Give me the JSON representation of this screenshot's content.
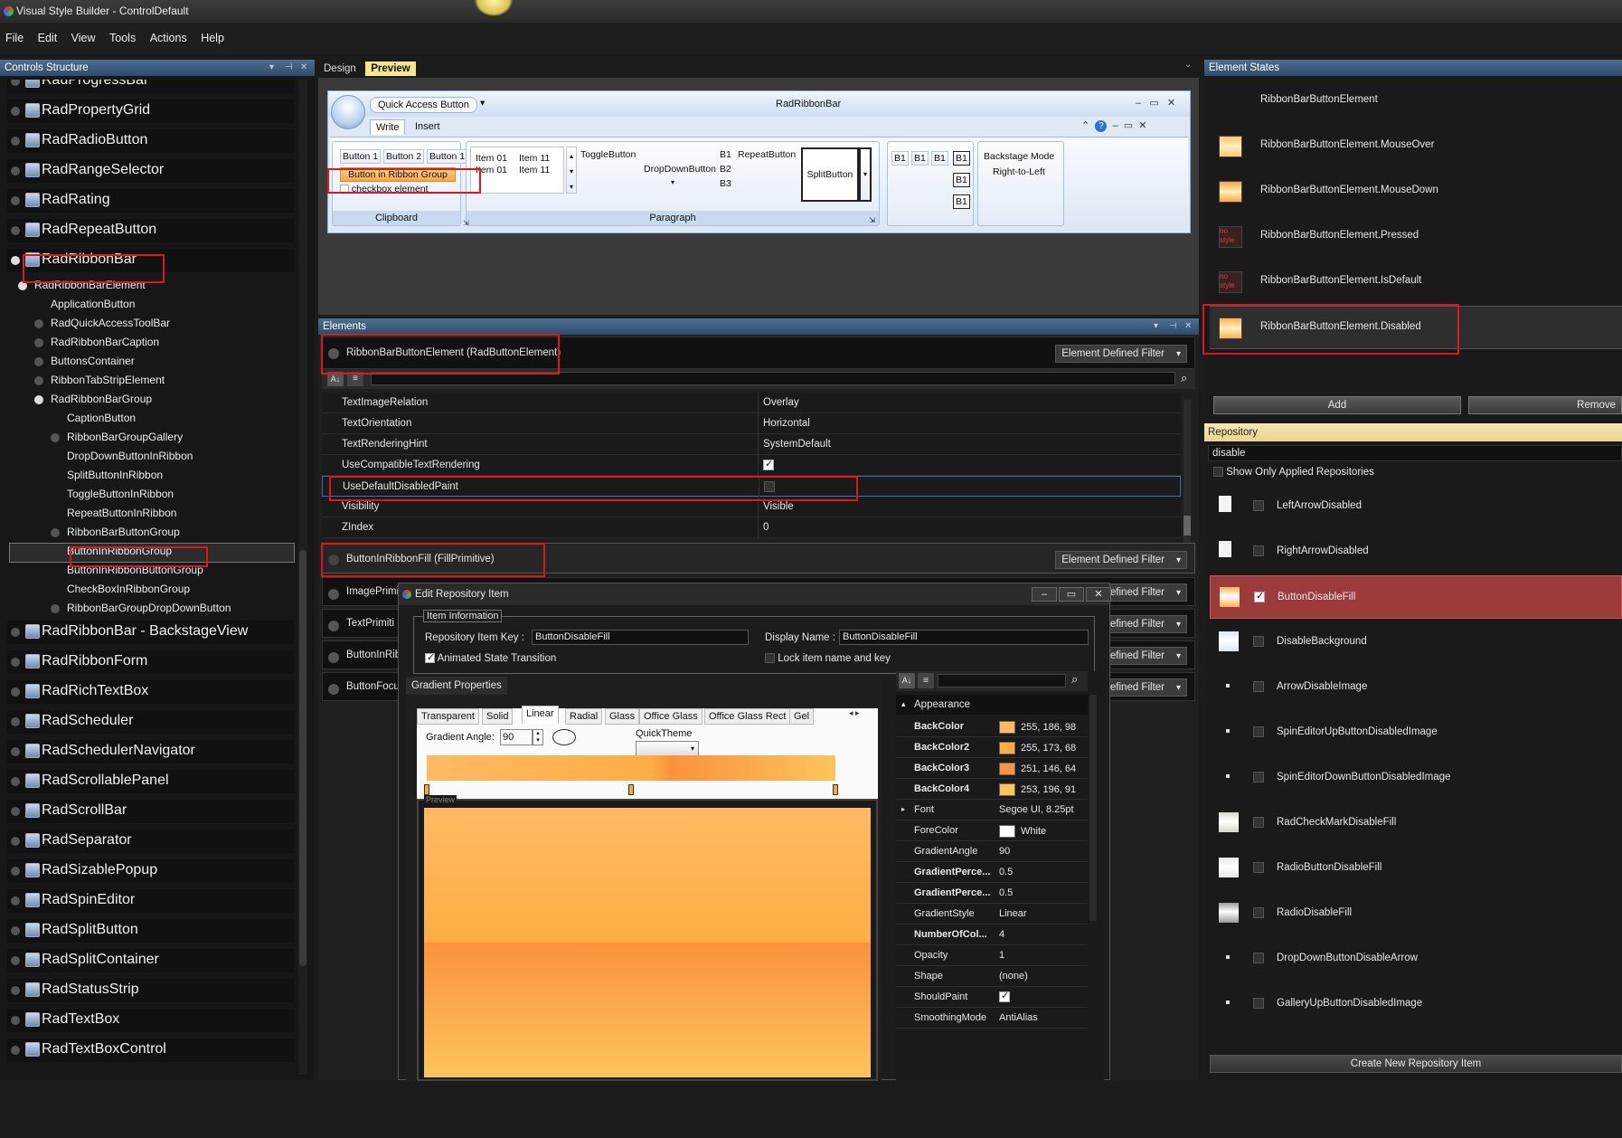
{
  "window": {
    "title": "Visual Style Builder - ControlDefault"
  },
  "menu": [
    "File",
    "Edit",
    "View",
    "Tools",
    "Actions",
    "Help"
  ],
  "left_panel": {
    "title": "Controls Structure",
    "items": [
      {
        "label": "RadProgressBar",
        "level": 0
      },
      {
        "label": "RadPropertyGrid",
        "level": 0
      },
      {
        "label": "RadRadioButton",
        "level": 0
      },
      {
        "label": "RadRangeSelector",
        "level": 0
      },
      {
        "label": "RadRating",
        "level": 0
      },
      {
        "label": "RadRepeatButton",
        "level": 0
      },
      {
        "label": "RadRibbonBar",
        "level": 0,
        "open": true
      },
      {
        "label": "RadRibbonBarElement",
        "level": 1,
        "open": true
      },
      {
        "label": "ApplicationButton",
        "level": 2
      },
      {
        "label": "RadQuickAccessToolBar",
        "level": 2,
        "expandable": true
      },
      {
        "label": "RadRibbonBarCaption",
        "level": 2,
        "expandable": true
      },
      {
        "label": "ButtonsContainer",
        "level": 2,
        "expandable": true
      },
      {
        "label": "RibbonTabStripElement",
        "level": 2,
        "expandable": true
      },
      {
        "label": "RadRibbonBarGroup",
        "level": 2,
        "open": true
      },
      {
        "label": "CaptionButton",
        "level": 3
      },
      {
        "label": "RibbonBarGroupGallery",
        "level": 3,
        "expandable": true
      },
      {
        "label": "DropDownButtonInRibbon",
        "level": 3
      },
      {
        "label": "SplitButtonInRibbon",
        "level": 3
      },
      {
        "label": "ToggleButtonInRibbon",
        "level": 3
      },
      {
        "label": "RepeatButtonInRibbon",
        "level": 3
      },
      {
        "label": "RibbonBarButtonGroup",
        "level": 3,
        "expandable": true
      },
      {
        "label": "ButtonInRibbonGroup",
        "level": 3,
        "selected": true
      },
      {
        "label": "ButtonInRibbonButtonGroup",
        "level": 3
      },
      {
        "label": "CheckBoxInRibbonGroup",
        "level": 3
      },
      {
        "label": "RibbonBarGroupDropDownButton",
        "level": 3,
        "expandable": true
      },
      {
        "label": "RadRibbonBar - BackstageView",
        "level": 0
      },
      {
        "label": "RadRibbonForm",
        "level": 0
      },
      {
        "label": "RadRichTextBox",
        "level": 0
      },
      {
        "label": "RadScheduler",
        "level": 0
      },
      {
        "label": "RadSchedulerNavigator",
        "level": 0
      },
      {
        "label": "RadScrollablePanel",
        "level": 0
      },
      {
        "label": "RadScrollBar",
        "level": 0
      },
      {
        "label": "RadSeparator",
        "level": 0
      },
      {
        "label": "RadSizablePopup",
        "level": 0
      },
      {
        "label": "RadSpinEditor",
        "level": 0
      },
      {
        "label": "RadSplitButton",
        "level": 0
      },
      {
        "label": "RadSplitContainer",
        "level": 0
      },
      {
        "label": "RadStatusStrip",
        "level": 0
      },
      {
        "label": "RadTextBox",
        "level": 0
      },
      {
        "label": "RadTextBoxControl",
        "level": 0
      }
    ]
  },
  "center_tabs": {
    "design": "Design",
    "preview": "Preview"
  },
  "ribbon": {
    "quick_access": "Quick Access Button",
    "title": "RadRibbonBar",
    "tabs": [
      "Write",
      "Insert"
    ],
    "clipboard": {
      "buttons": [
        "Button 1",
        "Button 2",
        "Button 1"
      ],
      "highlight": "Button in Ribbon Group",
      "checkbox": "checkbox element",
      "caption": "Clipboard"
    },
    "paragraph": {
      "items": [
        "Item 01",
        "Item 11",
        "Item 01",
        "Item 11"
      ],
      "toggle": "ToggleButton",
      "dropdown": "DropDownButton",
      "b_labels": [
        "B1",
        "B2",
        "B3"
      ],
      "repeat": "RepeatButton",
      "split": "SplitButton",
      "caption": "Paragraph"
    },
    "group3": {
      "b": [
        "B1",
        "B1",
        "B1",
        "B1",
        "B1",
        "B1"
      ]
    },
    "backstage": {
      "line1": "Backstage Mode",
      "line2": "Right-to-Left"
    }
  },
  "elements_panel": {
    "title": "Elements",
    "header1": "RibbonBarButtonElement (RadButtonElement)",
    "filter": "Element Defined Filter",
    "properties": [
      {
        "name": "TextImageRelation",
        "value": "Overlay"
      },
      {
        "name": "TextOrientation",
        "value": "Horizontal"
      },
      {
        "name": "TextRenderingHint",
        "value": "SystemDefault"
      },
      {
        "name": "UseCompatibleTextRendering",
        "value": "",
        "check": "on"
      },
      {
        "name": "UseDefaultDisabledPaint",
        "value": "",
        "check": "off"
      },
      {
        "name": "Visibility",
        "value": "Visible"
      },
      {
        "name": "ZIndex",
        "value": "0"
      }
    ],
    "header2": "ButtonInRibbonFill (FillPrimitive)",
    "collapsed": [
      "ImagePrimi",
      "TextPrimiti",
      "ButtonInRib",
      "ButtonFocu"
    ],
    "filter_partial": "efined Filter"
  },
  "dialog": {
    "title": "Edit Repository Item",
    "info_legend": "Item Information",
    "key_label": "Repository Item Key :",
    "key_value": "ButtonDisableFill",
    "display_label": "Display Name :",
    "display_value": "ButtonDisableFill",
    "animated": "Animated State Transition",
    "lock": "Lock item name and key",
    "gradient_tab": "Gradient Properties",
    "gradient_tabs": [
      "Transparent",
      "Solid",
      "Linear",
      "Radial",
      "Glass",
      "Office Glass",
      "Office Glass Rect",
      "Gel"
    ],
    "angle_label": "Gradient Angle:",
    "angle_value": "90",
    "quicktheme": "QuickTheme",
    "preview": "Preview",
    "props_category": "Appearance",
    "props": [
      {
        "name": "BackColor",
        "value": "255, 186, 98",
        "color": "#ffba62",
        "bold": true
      },
      {
        "name": "BackColor2",
        "value": "255, 173, 68",
        "color": "#ffad44",
        "bold": true
      },
      {
        "name": "BackColor3",
        "value": "251, 146, 64",
        "color": "#fb9240",
        "bold": true
      },
      {
        "name": "BackColor4",
        "value": "253, 196, 91",
        "color": "#fdc45b",
        "bold": true
      },
      {
        "name": "Font",
        "value": "Segoe UI, 8.25pt",
        "bold": false
      },
      {
        "name": "ForeColor",
        "value": "White",
        "color": "#ffffff",
        "bold": false
      },
      {
        "name": "GradientAngle",
        "value": "90",
        "bold": false
      },
      {
        "name": "GradientPerce...",
        "value": "0.5",
        "bold": true
      },
      {
        "name": "GradientPerce...",
        "value": "0.5",
        "bold": true
      },
      {
        "name": "GradientStyle",
        "value": "Linear",
        "bold": false
      },
      {
        "name": "NumberOfCol...",
        "value": "4",
        "bold": true
      },
      {
        "name": "Opacity",
        "value": "1",
        "bold": false
      },
      {
        "name": "Shape",
        "value": "(none)",
        "bold": false
      },
      {
        "name": "ShouldPaint",
        "value": "",
        "check": true,
        "bold": false
      },
      {
        "name": "SmoothingMode",
        "value": "AntiAlias",
        "bold": false
      }
    ]
  },
  "states_panel": {
    "title": "Element States",
    "states": [
      {
        "label": "RibbonBarButtonElement",
        "icon": "none"
      },
      {
        "label": "RibbonBarButtonElement.MouseOver",
        "icon": "#ffc66e"
      },
      {
        "label": "RibbonBarButtonElement.MouseDown",
        "icon": "#ffa33c"
      },
      {
        "label": "RibbonBarButtonElement.Pressed",
        "icon": "nostyle"
      },
      {
        "label": "RibbonBarButtonElement.IsDefault",
        "icon": "nostyle"
      },
      {
        "label": "RibbonBarButtonElement.Disabled",
        "icon": "#ffb04c",
        "selected": true
      }
    ],
    "nostyle_text": "no style",
    "add": "Add",
    "remove": "Remove"
  },
  "repository": {
    "title": "Repository",
    "search": "disable",
    "show_only": "Show Only Applied Repositories",
    "items": [
      {
        "label": "LeftArrowDisabled",
        "icon": "#f4f4f4"
      },
      {
        "label": "RightArrowDisabled",
        "icon": "#f4f4f4"
      },
      {
        "label": "ButtonDisableFill",
        "icon": "#ffb04c",
        "checked": true,
        "selected": true
      },
      {
        "label": "DisableBackground",
        "icon": "#dde6f0"
      },
      {
        "label": "ArrowDisableImage",
        "icon": "dot"
      },
      {
        "label": "SpinEditorUpButtonDisabledImage",
        "icon": "dot"
      },
      {
        "label": "SpinEditorDownButtonDisabledImage",
        "icon": "dot"
      },
      {
        "label": "RadCheckMarkDisableFill",
        "icon": "#d8d6cc"
      },
      {
        "label": "RadioButtonDisableFill",
        "icon": "#e8e8e8"
      },
      {
        "label": "RadioDisableFill",
        "icon": "#9a9a9a"
      },
      {
        "label": "DropDownButtonDisableArrow",
        "icon": "dot"
      },
      {
        "label": "GalleryUpButtonDisabledImage",
        "icon": "dot"
      }
    ],
    "create": "Create New Repository Item"
  }
}
